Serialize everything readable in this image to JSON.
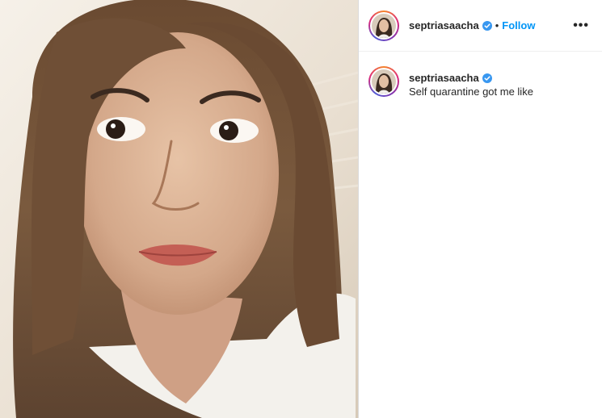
{
  "post": {
    "username": "septriasaacha",
    "follow_label": "Follow",
    "separator": "•",
    "more_label": "•••",
    "caption": "Self quarantine got me like"
  },
  "colors": {
    "accent_blue": "#0095f6",
    "text": "#262626",
    "border": "#dbdbdb"
  },
  "icons": {
    "verified": "verified-badge-icon",
    "more": "more-options-icon"
  }
}
